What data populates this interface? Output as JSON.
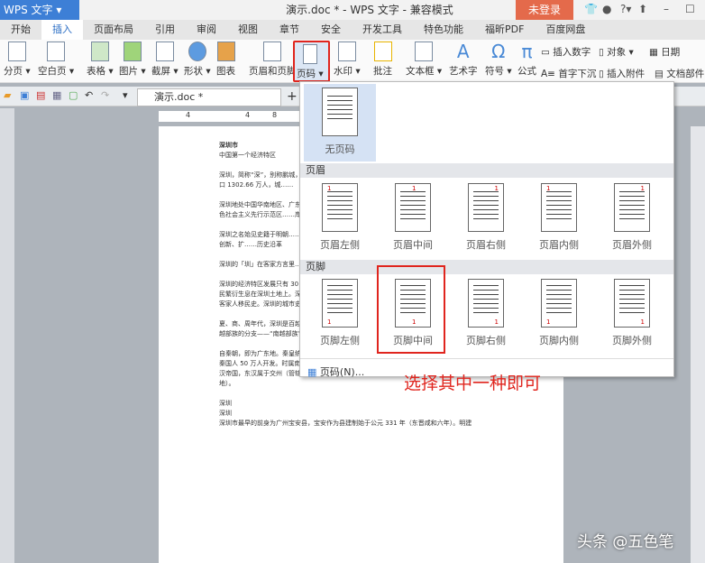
{
  "app": {
    "logo": "WPS 文字",
    "title": "演示.doc * - WPS 文字 - 兼容模式",
    "login": "未登录"
  },
  "tabs": [
    "开始",
    "插入",
    "页面布局",
    "引用",
    "审阅",
    "视图",
    "章节",
    "安全",
    "开发工具",
    "特色功能",
    "福昕PDF",
    "百度网盘"
  ],
  "ribbon": {
    "break": "分页 ▾",
    "blank": "空白页 ▾",
    "table": "表格 ▾",
    "picture": "图片 ▾",
    "screenshot": "截屏 ▾",
    "shape": "形状 ▾",
    "chart": "图表",
    "header_footer": "页眉和页脚",
    "page_number": "页码 ▾",
    "watermark": "水印 ▾",
    "comment": "批注",
    "textbox": "文本框 ▾",
    "wordart": "艺术字",
    "symbol": "符号 ▾",
    "formula": "公式",
    "insert_number": "插入数字",
    "object": "对象 ▾",
    "date": "日期",
    "dropcap": "首字下沉",
    "attachment": "插入附件",
    "docparts": "文档部件 ▾"
  },
  "doc_tab": "演示.doc *",
  "ruler": [
    "4",
    "4",
    "8"
  ],
  "dropdown": {
    "none": "无页码",
    "header_section": "页眉",
    "footer_section": "页脚",
    "header_opts": [
      "页眉左侧",
      "页眉中间",
      "页眉右侧",
      "页眉内侧",
      "页眉外侧"
    ],
    "footer_opts": [
      "页脚左侧",
      "页脚中间",
      "页脚右侧",
      "页脚内侧",
      "页脚外侧"
    ],
    "more": "页码(N)..."
  },
  "annotation": "选择其中一种即可",
  "watermark": "头条 @五色笔",
  "document": [
    "深圳市",
    "中国第一个经济特区",
    "深圳，简称“深”，别称鹏城，批复确定的中国经济特区……个区，总面积 1997.47 平方千米，常住人口 1302.66 万人，城……",
    "深圳地处中国华南地区、广东南部……洋，南隔深圳河与香港相连……国际科技产业创新中心……国特色社会主义先行示范区……岸数量最多、出入境人员……",
    "深圳之名始见史籍于明朝……年设置经济特区，是中国……圳在中国高新技术产业……也在中国的制度创新、扩……历史沿革",
    "深圳的「圳」在客家方言里……年）。",
    "深圳的经济特区发展只有 30 年，但却曾经有着 6700 多年的人类活动史，新石器时代中期就有土著居民繁衍生息在深圳土地上。深圳有 1700 多年的郡县史、600 多年的南头城、300 多年的大鹏城史和客家人移民史。深圳的城市史已有 1673 年。[1]",
    "夏、商、周年代，深圳是百越部族远征海洋的一个驻脚点。居留在深圳沿海沙丘谷地区域的百姓，是百越部族的分支——“南越部族”，他们以捕鱼、航海维生，甚少农耕。",
    "自秦朝，即为广东地。秦皇统一中国后，于公元前 214 年在岭南设置了南海、桂林、象郡三郡，调徙秦国人 50 万人开发。时属南海郡（郡治广州）的深圳，便融入了秦代的中原文化。后为南越国地。大汉帝国，东汉属于交州（管辖广东、广西、越南大部）南海郡。西汉设郡前属越地，南越地（南越地）。",
    "深圳",
    "深圳",
    "深圳市最早的前身为广州宝安县，宝安作为县建制始于公元 331 年（东晋咸和六年）。明建"
  ]
}
